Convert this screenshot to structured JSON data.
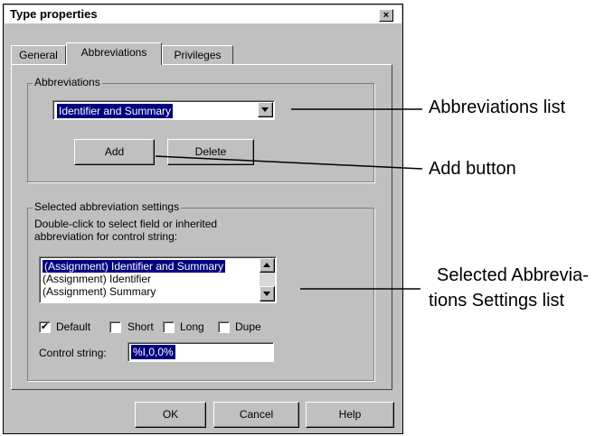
{
  "dialog": {
    "title": "Type properties",
    "close_glyph": "×"
  },
  "tabs": [
    {
      "label": "General"
    },
    {
      "label": "Abbreviations"
    },
    {
      "label": "Privileges"
    }
  ],
  "abbreviations_group": {
    "legend": "Abbreviations",
    "selected_value": "Identifier and Summary",
    "add_label": "Add",
    "delete_label": "Delete"
  },
  "settings_group": {
    "legend": "Selected abbreviation settings",
    "instruction_line1": "Double-click to select field or inherited",
    "instruction_line2": "abbreviation for control string:",
    "list_items": [
      "(Assignment) Identifier and Summary",
      "(Assignment) Identifier",
      "(Assignment) Summary"
    ],
    "checkboxes": [
      {
        "label": "Default",
        "checked": true,
        "mark": "✔"
      },
      {
        "label": "Short",
        "checked": false,
        "mark": ""
      },
      {
        "label": "Long",
        "checked": false,
        "mark": ""
      },
      {
        "label": "Dupe",
        "checked": false,
        "mark": ""
      }
    ],
    "control_string_label": "Control string:",
    "control_string_value": "%I,0,0%"
  },
  "footer": {
    "ok_label": "OK",
    "cancel_label": "Cancel",
    "help_label": "Help"
  },
  "callouts": {
    "abbreviations_list": "Abbreviations list",
    "add_button": "Add button",
    "selected_line1": "Selected Abbrevia-",
    "selected_line2": "tions Settings list"
  }
}
